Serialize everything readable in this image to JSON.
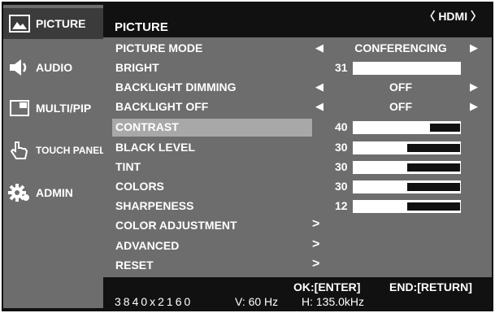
{
  "sidebar": {
    "items": [
      {
        "label": "PICTURE",
        "icon": "picture-icon",
        "active": true
      },
      {
        "label": "AUDIO",
        "icon": "speaker-icon",
        "active": false
      },
      {
        "label": "MULTI/PIP",
        "icon": "multi-pip-icon",
        "active": false
      },
      {
        "label": "TOUCH PANEL",
        "icon": "touch-hand-icon",
        "active": false
      },
      {
        "label": "ADMIN",
        "icon": "admin-gear-icon",
        "active": false
      }
    ]
  },
  "header": {
    "title": "PICTURE",
    "source": "〈 HDMI 〉"
  },
  "menu": {
    "picture_mode": {
      "label": "PICTURE MODE",
      "value": "CONFERENCING"
    },
    "bright": {
      "label": "BRIGHT",
      "value": "31",
      "level": 1.0
    },
    "backlight_dimming": {
      "label": "BACKLIGHT DIMMING",
      "value": "OFF"
    },
    "backlight_off": {
      "label": "BACKLIGHT OFF",
      "value": "OFF"
    },
    "contrast": {
      "label": "CONTRAST",
      "value": "40",
      "level": 0.72
    },
    "black_level": {
      "label": "BLACK LEVEL",
      "value": "30",
      "level": 0.5
    },
    "tint": {
      "label": "TINT",
      "value": "30",
      "level": 0.5
    },
    "colors": {
      "label": "COLORS",
      "value": "30",
      "level": 0.5
    },
    "sharpeness": {
      "label": "SHARPENESS",
      "value": "12",
      "level": 0.5
    },
    "color_adjustment": {
      "label": "COLOR ADJUSTMENT"
    },
    "advanced": {
      "label": "ADVANCED"
    },
    "reset": {
      "label": "RESET"
    }
  },
  "footer": {
    "ok": "OK:[ENTER]",
    "end": "END:[RETURN]",
    "resolution": "3840x2160",
    "vfreq": "V: 60 Hz",
    "hfreq": "H: 135.0kHz"
  },
  "colors": {
    "osd_bg": "#111111",
    "panel": "#6d6d6d",
    "highlight": "#a8a8a8",
    "active_tab": "#3b3b3b"
  }
}
